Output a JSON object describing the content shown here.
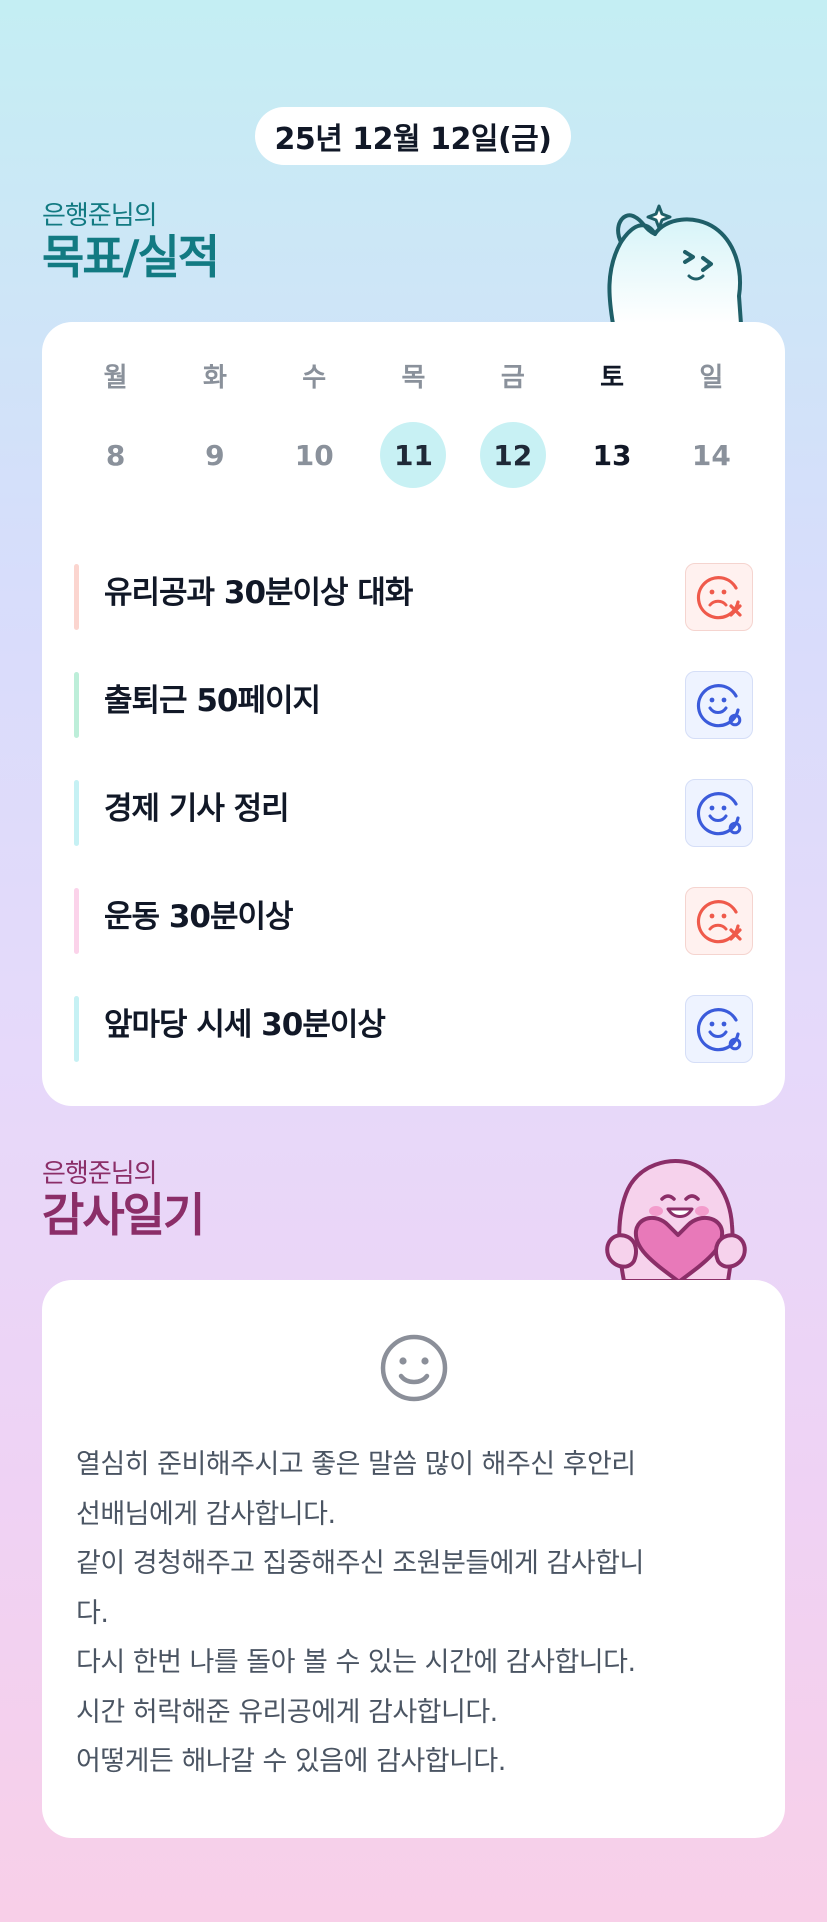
{
  "header": {
    "date": "25년 12월 12일(금)"
  },
  "goals_section": {
    "subtitle": "은행준님의",
    "title": "목표/실적"
  },
  "calendar": {
    "days": [
      {
        "name": "월",
        "date": "8",
        "state": "normal"
      },
      {
        "name": "화",
        "date": "9",
        "state": "normal"
      },
      {
        "name": "수",
        "date": "10",
        "state": "normal"
      },
      {
        "name": "목",
        "date": "11",
        "state": "highlight"
      },
      {
        "name": "금",
        "date": "12",
        "state": "highlight"
      },
      {
        "name": "토",
        "date": "13",
        "state": "active"
      },
      {
        "name": "일",
        "date": "14",
        "state": "normal"
      }
    ]
  },
  "goals": [
    {
      "text": "유리공과 30분이상 대화",
      "accent": "#fbd5cf",
      "status": "fail",
      "status_icon": "sad-face-x-icon"
    },
    {
      "text": "출퇴근 50페이지",
      "accent": "#bdeed9",
      "status": "success",
      "status_icon": "smile-face-check-icon"
    },
    {
      "text": "경제 기사 정리",
      "accent": "#c6f1f4",
      "status": "success",
      "status_icon": "smile-face-check-icon"
    },
    {
      "text": "운동 30분이상",
      "accent": "#fbd3ea",
      "status": "fail",
      "status_icon": "sad-face-x-icon"
    },
    {
      "text": "앞마당 시세 30분이상",
      "accent": "#c6f1f4",
      "status": "success",
      "status_icon": "smile-face-check-icon"
    }
  ],
  "gratitude_section": {
    "subtitle": "은행준님의",
    "title": "감사일기",
    "icon": "smile-icon",
    "text": "열심히 준비해주시고 좋은 말씀 많이 해주신 후안리\n선배님에게 감사합니다.\n같이 경청해주고 집중해주신 조원분들에게 감사합니\n다.\n다시 한번 나를 돌아 볼 수 있는 시간에 감사합니다.\n시간 허락해준 유리공에게 감사합니다.\n어떻게든 해나갈 수 있음에 감사합니다."
  },
  "colors": {
    "teal_accent": "#127a82",
    "plum_accent": "#8b2e68",
    "highlight_day": "#c8f1f4",
    "fail_red": "#ef5a4b",
    "success_blue": "#3b5bdb"
  }
}
